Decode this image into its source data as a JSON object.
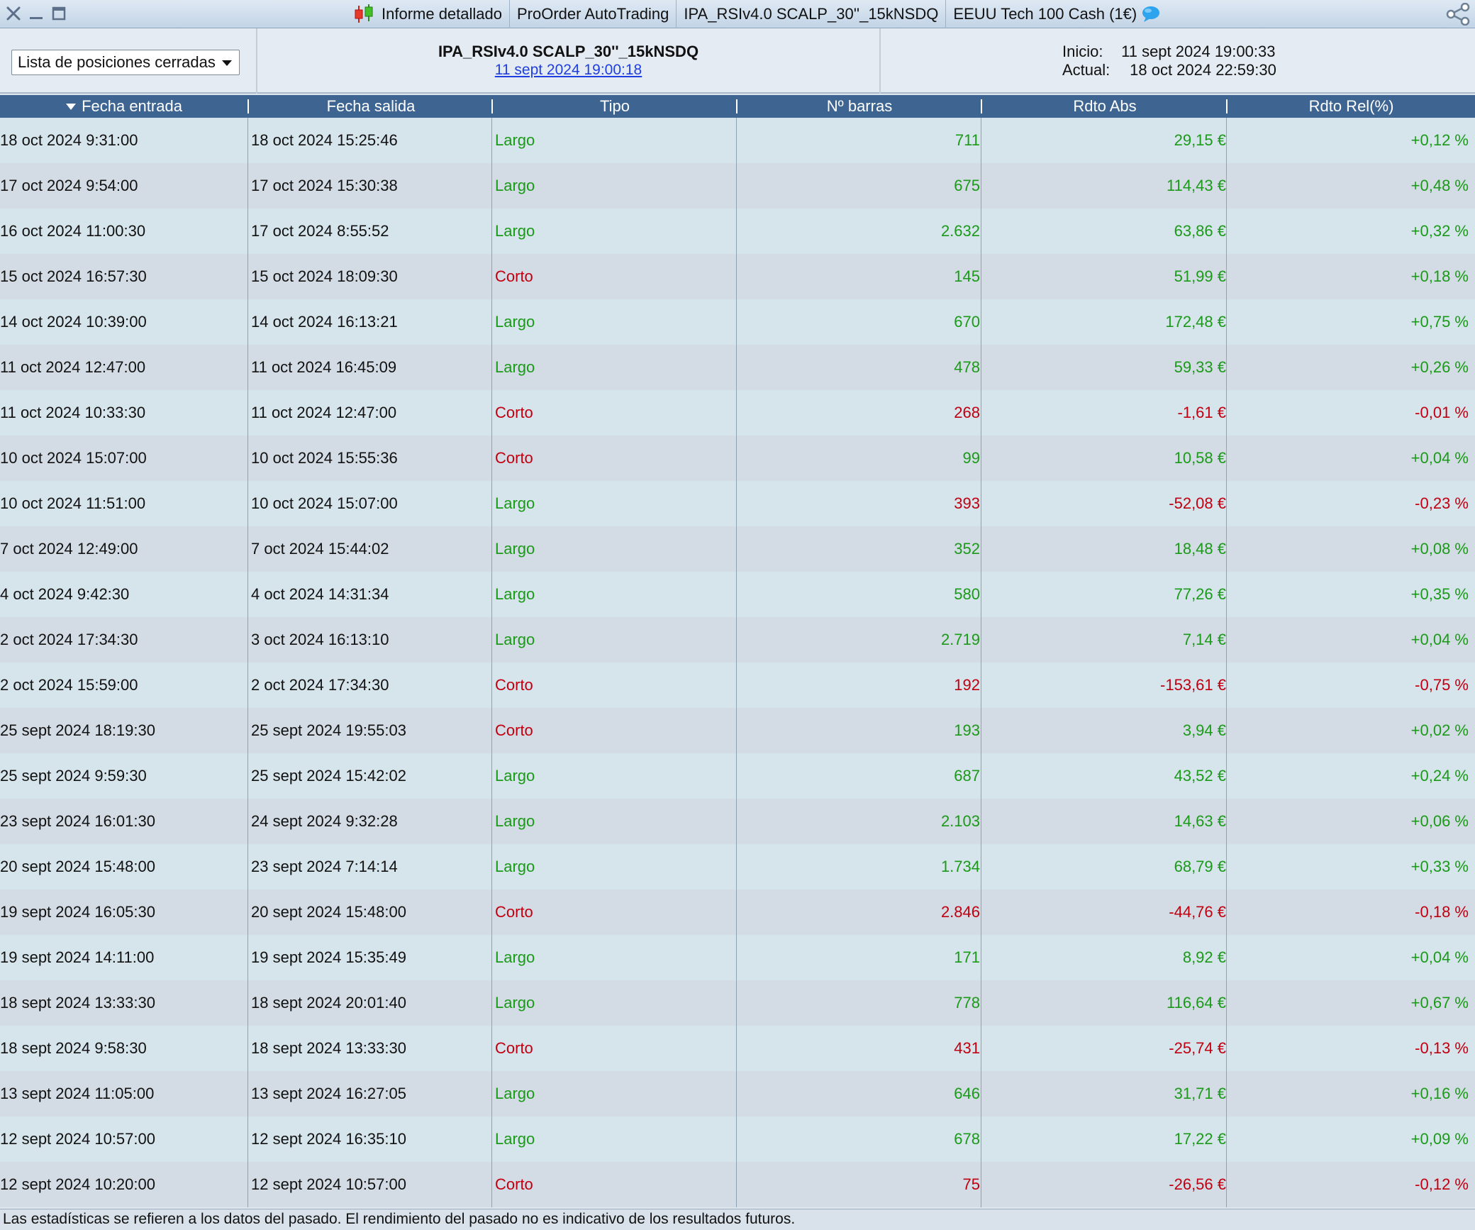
{
  "window": {
    "tabs": [
      {
        "label": "Informe detallado",
        "icon": "candlestick-icon"
      },
      {
        "label": "ProOrder AutoTrading"
      },
      {
        "label": "IPA_RSIv4.0 SCALP_30''_15kNSDQ"
      },
      {
        "label": "EEUU Tech 100 Cash (1€)",
        "icon": "chat-bubble-icon"
      }
    ]
  },
  "header": {
    "view_select": "Lista de posiciones cerradas",
    "system_name": "IPA_RSIv4.0 SCALP_30''_15kNSDQ",
    "system_date": "11 sept 2024 19:00:18",
    "start_label": "Inicio:",
    "start_value": "11 sept 2024 19:00:33",
    "current_label": "Actual:",
    "current_value": "18 oct 2024 22:59:30"
  },
  "table": {
    "columns": [
      "Fecha entrada",
      "Fecha salida",
      "Tipo",
      "Nº barras",
      "Rdto Abs",
      "Rdto Rel(%)"
    ],
    "rows": [
      {
        "entry": "18 oct 2024 9:31:00",
        "exit": "18 oct 2024 15:25:46",
        "type": "Largo",
        "bars": "711",
        "abs": "29,15 €",
        "rel": "+0,12 %"
      },
      {
        "entry": "17 oct 2024 9:54:00",
        "exit": "17 oct 2024 15:30:38",
        "type": "Largo",
        "bars": "675",
        "abs": "114,43 €",
        "rel": "+0,48 %"
      },
      {
        "entry": "16 oct 2024 11:00:30",
        "exit": "17 oct 2024 8:55:52",
        "type": "Largo",
        "bars": "2.632",
        "abs": "63,86 €",
        "rel": "+0,32 %"
      },
      {
        "entry": "15 oct 2024 16:57:30",
        "exit": "15 oct 2024 18:09:30",
        "type": "Corto",
        "bars": "145",
        "abs": "51,99 €",
        "rel": "+0,18 %"
      },
      {
        "entry": "14 oct 2024 10:39:00",
        "exit": "14 oct 2024 16:13:21",
        "type": "Largo",
        "bars": "670",
        "abs": "172,48 €",
        "rel": "+0,75 %"
      },
      {
        "entry": "11 oct 2024 12:47:00",
        "exit": "11 oct 2024 16:45:09",
        "type": "Largo",
        "bars": "478",
        "abs": "59,33 €",
        "rel": "+0,26 %"
      },
      {
        "entry": "11 oct 2024 10:33:30",
        "exit": "11 oct 2024 12:47:00",
        "type": "Corto",
        "bars": "268",
        "abs": "-1,61 €",
        "rel": "-0,01 %"
      },
      {
        "entry": "10 oct 2024 15:07:00",
        "exit": "10 oct 2024 15:55:36",
        "type": "Corto",
        "bars": "99",
        "abs": "10,58 €",
        "rel": "+0,04 %"
      },
      {
        "entry": "10 oct 2024 11:51:00",
        "exit": "10 oct 2024 15:07:00",
        "type": "Largo",
        "bars": "393",
        "abs": "-52,08 €",
        "rel": "-0,23 %"
      },
      {
        "entry": "7 oct 2024 12:49:00",
        "exit": "7 oct 2024 15:44:02",
        "type": "Largo",
        "bars": "352",
        "abs": "18,48 €",
        "rel": "+0,08 %"
      },
      {
        "entry": "4 oct 2024 9:42:30",
        "exit": "4 oct 2024 14:31:34",
        "type": "Largo",
        "bars": "580",
        "abs": "77,26 €",
        "rel": "+0,35 %"
      },
      {
        "entry": "2 oct 2024 17:34:30",
        "exit": "3 oct 2024 16:13:10",
        "type": "Largo",
        "bars": "2.719",
        "abs": "7,14 €",
        "rel": "+0,04 %"
      },
      {
        "entry": "2 oct 2024 15:59:00",
        "exit": "2 oct 2024 17:34:30",
        "type": "Corto",
        "bars": "192",
        "abs": "-153,61 €",
        "rel": "-0,75 %"
      },
      {
        "entry": "25 sept 2024 18:19:30",
        "exit": "25 sept 2024 19:55:03",
        "type": "Corto",
        "bars": "193",
        "abs": "3,94 €",
        "rel": "+0,02 %"
      },
      {
        "entry": "25 sept 2024 9:59:30",
        "exit": "25 sept 2024 15:42:02",
        "type": "Largo",
        "bars": "687",
        "abs": "43,52 €",
        "rel": "+0,24 %"
      },
      {
        "entry": "23 sept 2024 16:01:30",
        "exit": "24 sept 2024 9:32:28",
        "type": "Largo",
        "bars": "2.103",
        "abs": "14,63 €",
        "rel": "+0,06 %"
      },
      {
        "entry": "20 sept 2024 15:48:00",
        "exit": "23 sept 2024 7:14:14",
        "type": "Largo",
        "bars": "1.734",
        "abs": "68,79 €",
        "rel": "+0,33 %"
      },
      {
        "entry": "19 sept 2024 16:05:30",
        "exit": "20 sept 2024 15:48:00",
        "type": "Corto",
        "bars": "2.846",
        "abs": "-44,76 €",
        "rel": "-0,18 %"
      },
      {
        "entry": "19 sept 2024 14:11:00",
        "exit": "19 sept 2024 15:35:49",
        "type": "Largo",
        "bars": "171",
        "abs": "8,92 €",
        "rel": "+0,04 %"
      },
      {
        "entry": "18 sept 2024 13:33:30",
        "exit": "18 sept 2024 20:01:40",
        "type": "Largo",
        "bars": "778",
        "abs": "116,64 €",
        "rel": "+0,67 %"
      },
      {
        "entry": "18 sept 2024 9:58:30",
        "exit": "18 sept 2024 13:33:30",
        "type": "Corto",
        "bars": "431",
        "abs": "-25,74 €",
        "rel": "-0,13 %"
      },
      {
        "entry": "13 sept 2024 11:05:00",
        "exit": "13 sept 2024 16:27:05",
        "type": "Largo",
        "bars": "646",
        "abs": "31,71 €",
        "rel": "+0,16 %"
      },
      {
        "entry": "12 sept 2024 10:57:00",
        "exit": "12 sept 2024 16:35:10",
        "type": "Largo",
        "bars": "678",
        "abs": "17,22 €",
        "rel": "+0,09 %"
      },
      {
        "entry": "12 sept 2024 10:20:00",
        "exit": "12 sept 2024 10:57:00",
        "type": "Corto",
        "bars": "75",
        "abs": "-26,56 €",
        "rel": "-0,12 %"
      }
    ]
  },
  "footer": {
    "disclaimer": "Las estadísticas se refieren a los datos del pasado. El rendimiento del pasado no es indicativo de los resultados futuros."
  },
  "colors": {
    "positive": "#1a9a18",
    "negative": "#c00010",
    "header_bg": "#3e6592",
    "link": "#1f3fe0"
  }
}
